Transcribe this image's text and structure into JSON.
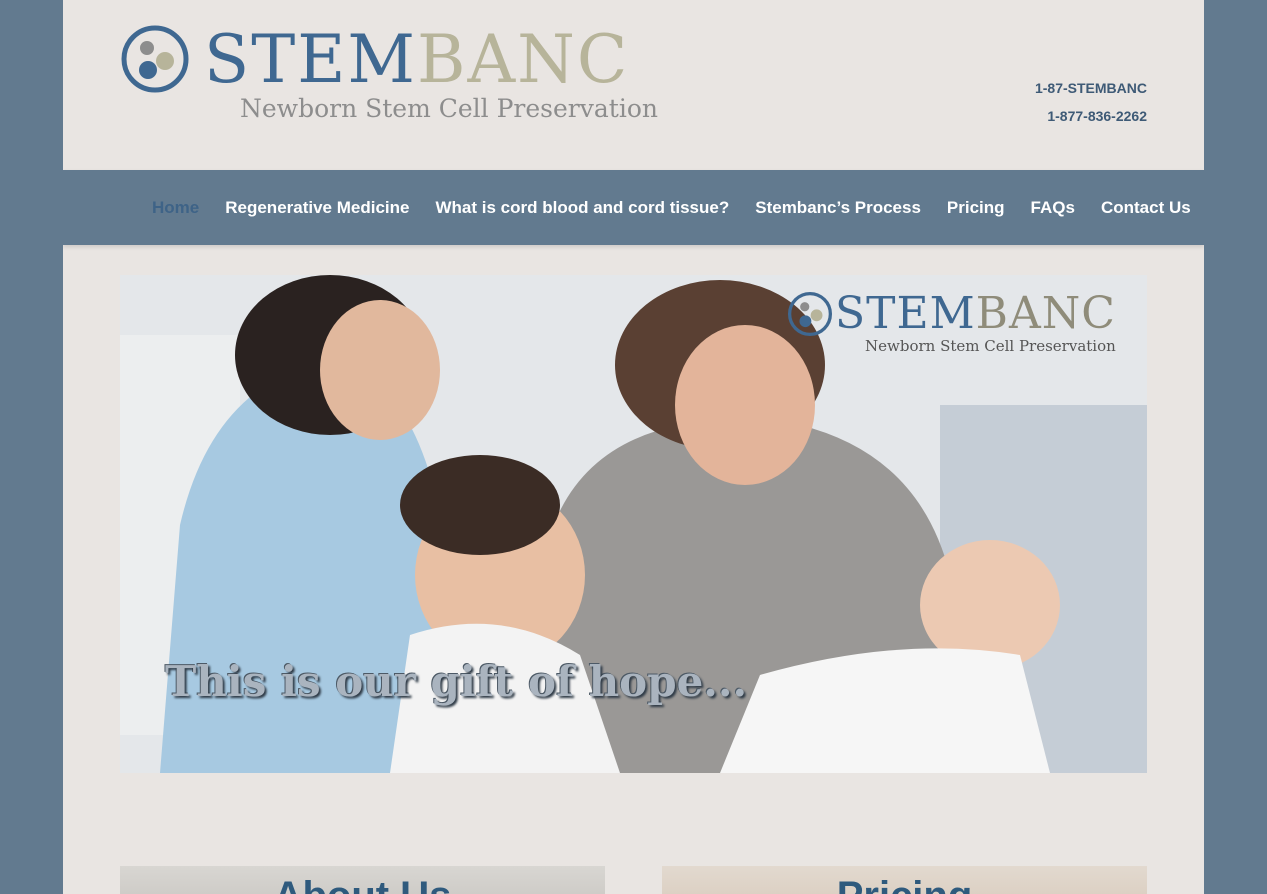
{
  "header": {
    "logo": {
      "word_part1": "STEM",
      "word_part2": "BANC",
      "tagline": "Newborn Stem Cell Preservation"
    },
    "phones": [
      "1-87-STEMBANC",
      "1-877-836-2262"
    ]
  },
  "nav": {
    "items": [
      {
        "label": "Home",
        "active": true
      },
      {
        "label": "Regenerative Medicine",
        "active": false
      },
      {
        "label": "What is cord blood and cord tissue?",
        "active": false
      },
      {
        "label": "Stembanc’s Process",
        "active": false
      },
      {
        "label": "Pricing",
        "active": false
      },
      {
        "label": "FAQs",
        "active": false
      },
      {
        "label": "Contact Us",
        "active": false
      }
    ]
  },
  "hero": {
    "brand_word_part1": "STEM",
    "brand_word_part2": "BANC",
    "brand_tagline": "Newborn Stem Cell Preservation",
    "caption": "This is our gift of hope..."
  },
  "cards": [
    {
      "title": "About Us"
    },
    {
      "title": "Pricing"
    }
  ],
  "colors": {
    "background": "#627a8f",
    "page": "#e9e5e2",
    "brand_blue": "#3f6891",
    "brand_tan": "#b7b49a",
    "nav_active": "#3e6387"
  }
}
